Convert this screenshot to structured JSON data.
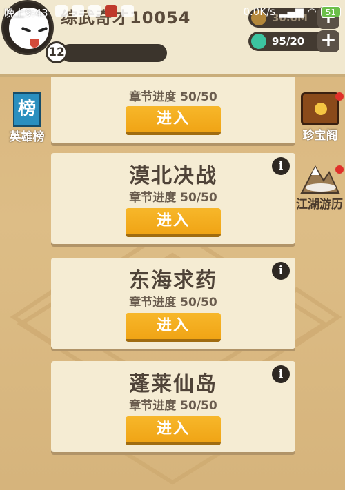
{
  "status_bar": {
    "time": "晚上9:43",
    "network_speed": "0.0K/s",
    "battery": "51"
  },
  "player": {
    "name": "综武奇才10054",
    "level": "12"
  },
  "resources": {
    "coins": "30.0M",
    "gems": "95/20"
  },
  "side_left": {
    "hero_rank_icon_text": "榜",
    "hero_rank_label": "英雄榜"
  },
  "side_right": {
    "treasure_label": "珍宝阁",
    "jianghu_label": "江湖游历"
  },
  "chapters": [
    {
      "title": "",
      "progress": "章节进度 50/50",
      "enter_label": "进入"
    },
    {
      "title": "漠北决战",
      "progress": "章节进度 50/50",
      "enter_label": "进入"
    },
    {
      "title": "东海求药",
      "progress": "章节进度 50/50",
      "enter_label": "进入"
    },
    {
      "title": "蓬莱仙岛",
      "progress": "章节进度 50/50",
      "enter_label": "进入"
    }
  ],
  "colors": {
    "background": "#d9b981",
    "card": "#f5ecd3",
    "enter_button": "#f4ad1f",
    "panel": "#f1e8cf"
  }
}
